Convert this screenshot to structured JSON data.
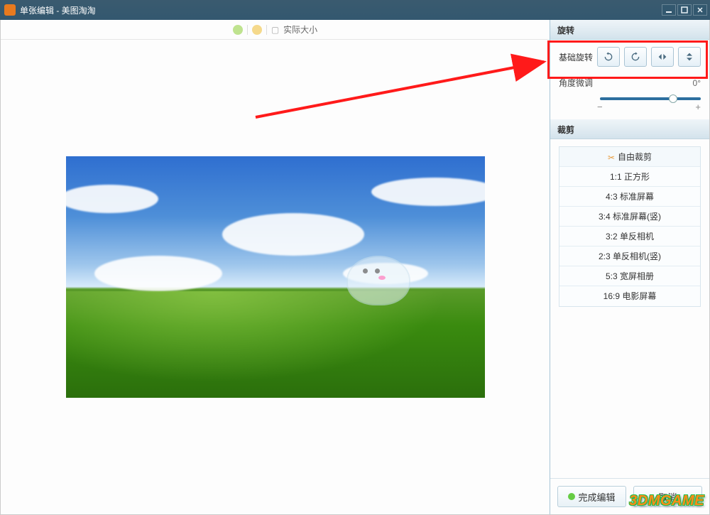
{
  "titlebar": {
    "title": "单张编辑 - 美图淘淘"
  },
  "canvas_toolbar": {
    "actual_size_label": "实际大小"
  },
  "rotate_panel": {
    "header": "旋转",
    "basic_rotate_label": "基础旋转",
    "buttons": {
      "ccw": "rotate-ccw",
      "cw": "rotate-cw",
      "flip_h": "flip-horizontal",
      "flip_v": "flip-vertical"
    },
    "angle_label": "角度微调",
    "angle_value": "0°",
    "slider_minus": "−",
    "slider_plus": "+"
  },
  "crop_panel": {
    "header": "裁剪",
    "options": [
      "自由裁剪",
      "1:1 正方形",
      "4:3 标准屏幕",
      "3:4 标准屏幕(竖)",
      "3:2 单反相机",
      "2:3 单反相机(竖)",
      "5:3 宽屏相册",
      "16:9 电影屏幕"
    ]
  },
  "footer": {
    "done_label": "完成编辑",
    "cancel_label": "取消"
  },
  "watermark": "3DMGAME"
}
